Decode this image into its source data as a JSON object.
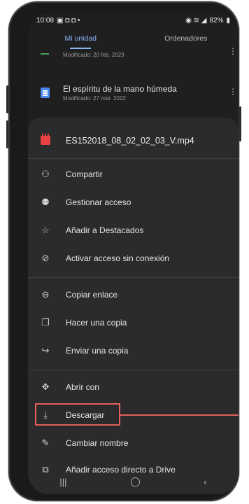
{
  "status_bar": {
    "time": "10:08",
    "battery": "82%"
  },
  "tabs": [
    {
      "label": "Mi unidad",
      "active": true
    },
    {
      "label": "Ordenadores",
      "active": false
    }
  ],
  "files": [
    {
      "title": "",
      "meta": "Modificado: 20 feb. 2023"
    },
    {
      "title": "El espíritu de la mano húmeda",
      "meta": "Modificado: 27 mar. 2022"
    }
  ],
  "sheet": {
    "file_name": "ES152018_08_02_02_03_V.mp4",
    "items": [
      {
        "icon": "add-person-icon",
        "label": "Compartir"
      },
      {
        "icon": "people-icon",
        "label": "Gestionar acceso"
      },
      {
        "icon": "star-icon",
        "label": "Añadir a Destacados"
      },
      {
        "icon": "offline-icon",
        "label": "Activar acceso sin conexión"
      },
      {
        "icon": "link-icon",
        "label": "Copiar enlace"
      },
      {
        "icon": "copy-icon",
        "label": "Hacer una copia"
      },
      {
        "icon": "send-copy-icon",
        "label": "Enviar una copia"
      },
      {
        "icon": "open-with-icon",
        "label": "Abrir con"
      },
      {
        "icon": "download-icon",
        "label": "Descargar"
      },
      {
        "icon": "rename-icon",
        "label": "Cambiar nombre"
      },
      {
        "icon": "drive-shortcut-icon",
        "label": "Añadir acceso directo a Drive"
      }
    ]
  },
  "highlight_color": "#e0605c",
  "accent_color": "#8ab4f8"
}
